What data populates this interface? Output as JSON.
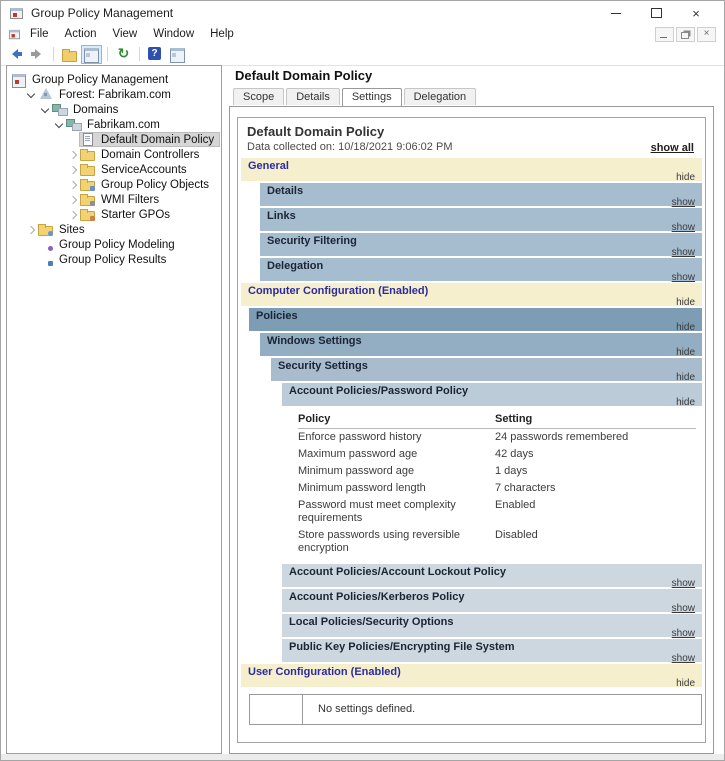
{
  "window": {
    "title": "Group Policy Management"
  },
  "titlebar": {
    "buttons": [
      "minimize",
      "maximize",
      "close"
    ]
  },
  "menubar": {
    "items": [
      "File",
      "Action",
      "View",
      "Window",
      "Help"
    ]
  },
  "toolbar": {
    "icons": [
      "back",
      "forward",
      "separator",
      "upfolder",
      "console-tree",
      "separator",
      "refresh",
      "separator",
      "help",
      "console-window"
    ]
  },
  "tree": {
    "items": [
      {
        "label": "Group Policy Management",
        "level": 0,
        "chevron": "none",
        "icon": "console-root",
        "selected": false
      },
      {
        "label": "Forest: Fabrikam.com",
        "level": 1,
        "chevron": "expanded",
        "icon": "forest",
        "selected": false
      },
      {
        "label": "Domains",
        "level": 2,
        "chevron": "expanded",
        "icon": "domains",
        "selected": false
      },
      {
        "label": "Fabrikam.com",
        "level": 3,
        "chevron": "expanded",
        "icon": "domain",
        "selected": false
      },
      {
        "label": "Default Domain Policy",
        "level": 4,
        "chevron": "none",
        "icon": "gpo",
        "selected": true
      },
      {
        "label": "Domain Controllers",
        "level": 4,
        "chevron": "collapsed",
        "icon": "ou-folder",
        "selected": false
      },
      {
        "label": "ServiceAccounts",
        "level": 4,
        "chevron": "collapsed",
        "icon": "ou-folder",
        "selected": false
      },
      {
        "label": "Group Policy Objects",
        "level": 4,
        "chevron": "collapsed",
        "icon": "gpo-folder",
        "selected": false
      },
      {
        "label": "WMI Filters",
        "level": 4,
        "chevron": "collapsed",
        "icon": "wmi-folder",
        "selected": false
      },
      {
        "label": "Starter GPOs",
        "level": 4,
        "chevron": "collapsed",
        "icon": "starter-folder",
        "selected": false
      },
      {
        "label": "Sites",
        "level": 1,
        "chevron": "collapsed",
        "icon": "sites-folder",
        "selected": false
      },
      {
        "label": "Group Policy Modeling",
        "level": 1,
        "chevron": "none",
        "icon": "modeling",
        "selected": false
      },
      {
        "label": "Group Policy Results",
        "level": 1,
        "chevron": "none",
        "icon": "results",
        "selected": false
      }
    ]
  },
  "panel": {
    "title": "Default Domain Policy",
    "tabs": [
      "Scope",
      "Details",
      "Settings",
      "Delegation"
    ],
    "active_tab": "Settings"
  },
  "report": {
    "title": "Default Domain Policy",
    "collected": "Data collected on: 10/18/2021 9:06:02 PM",
    "show_all_label": "show all",
    "sections": [
      {
        "type": "header",
        "label": "General",
        "link": "hide"
      },
      {
        "type": "bar",
        "label": "Details",
        "link": "show",
        "depth": 2,
        "tone": "mid"
      },
      {
        "type": "bar",
        "label": "Links",
        "link": "show",
        "depth": 2,
        "tone": "mid"
      },
      {
        "type": "bar",
        "label": "Security Filtering",
        "link": "show",
        "depth": 2,
        "tone": "mid"
      },
      {
        "type": "bar",
        "label": "Delegation",
        "link": "show",
        "depth": 2,
        "tone": "mid"
      },
      {
        "type": "header",
        "label": "Computer Configuration (Enabled)",
        "link": "hide"
      },
      {
        "type": "bar",
        "label": "Policies",
        "link": "hide",
        "depth": 1,
        "tone": "l1"
      },
      {
        "type": "bar",
        "label": "Windows Settings",
        "link": "hide",
        "depth": 2,
        "tone": "l2"
      },
      {
        "type": "bar",
        "label": "Security Settings",
        "link": "hide",
        "depth": 3,
        "tone": "l3"
      },
      {
        "type": "bar",
        "label": "Account Policies/Password Policy",
        "link": "hide",
        "depth": 4,
        "tone": "l4"
      },
      {
        "type": "table"
      },
      {
        "type": "bar",
        "label": "Account Policies/Account Lockout Policy",
        "link": "show",
        "depth": 4,
        "tone": "l5"
      },
      {
        "type": "bar",
        "label": "Account Policies/Kerberos Policy",
        "link": "show",
        "depth": 4,
        "tone": "l5"
      },
      {
        "type": "bar",
        "label": "Local Policies/Security Options",
        "link": "show",
        "depth": 4,
        "tone": "l5"
      },
      {
        "type": "bar",
        "label": "Public Key Policies/Encrypting File System",
        "link": "show",
        "depth": 4,
        "tone": "l5"
      },
      {
        "type": "header",
        "label": "User Configuration (Enabled)",
        "link": "hide"
      },
      {
        "type": "noset"
      }
    ],
    "password_table": {
      "headers": [
        "Policy",
        "Setting"
      ],
      "rows": [
        [
          "Enforce password history",
          "24 passwords remembered"
        ],
        [
          "Maximum password age",
          "42 days"
        ],
        [
          "Minimum password age",
          "1 days"
        ],
        [
          "Minimum password length",
          "7 characters"
        ],
        [
          "Password must meet complexity requirements",
          "Enabled"
        ],
        [
          "Store passwords using reversible encryption",
          "Disabled"
        ]
      ]
    },
    "no_settings_text": "No settings defined."
  },
  "colors": {
    "band_yellow": "#f6efcd",
    "band_yellow_text": "#2b2ba0",
    "bar_mid": "#a6bdd0",
    "bar_l1": "#7d9db5",
    "bar_l2": "#93adc2",
    "bar_l3": "#a9bccd",
    "bar_l4": "#bccbd8",
    "bar_l5": "#ccd7e0"
  }
}
